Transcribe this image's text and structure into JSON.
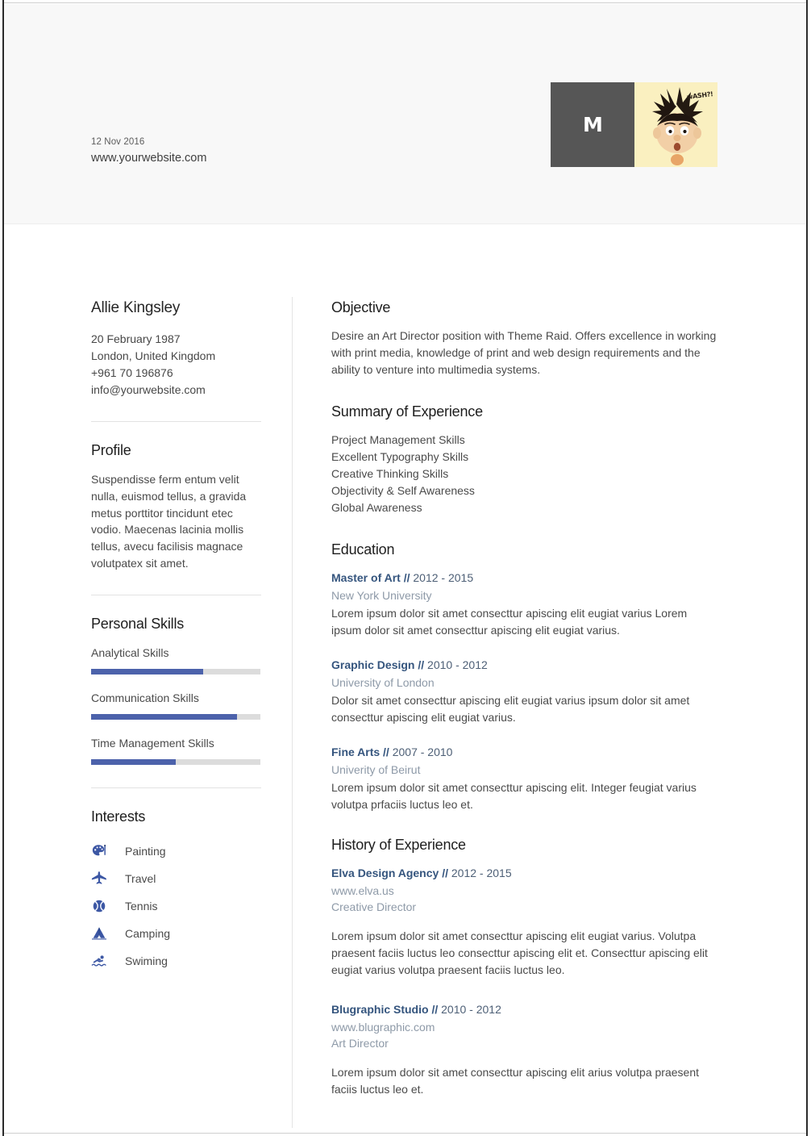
{
  "header": {
    "date": "12 Nov 2016",
    "website": "www.yourwebsite.com",
    "logo_letter": "M",
    "photo_caption": "wASH?!"
  },
  "sidebar": {
    "name": "Allie Kingsley",
    "contact": [
      "20 February 1987",
      "London, United Kingdom",
      "+961 70 196876",
      "info@yourwebsite.com"
    ],
    "profile": {
      "title": "Profile",
      "text": "Suspendisse ferm entum velit nulla, euismod tellus, a gravida metus porttitor tincidunt etec vodio. Maecenas lacinia mollis tellus, avecu facilisis magnace volutpatex sit amet."
    },
    "personal_skills": {
      "title": "Personal Skills",
      "items": [
        {
          "label": "Analytical Skills",
          "value": 66
        },
        {
          "label": "Communication Skills",
          "value": 86
        },
        {
          "label": "Time Management Skills",
          "value": 50
        }
      ]
    },
    "interests": {
      "title": "Interests",
      "items": [
        {
          "label": "Painting",
          "icon": "palette-icon"
        },
        {
          "label": "Travel",
          "icon": "airplane-icon"
        },
        {
          "label": "Tennis",
          "icon": "tennis-ball-icon"
        },
        {
          "label": "Camping",
          "icon": "tent-icon"
        },
        {
          "label": "Swiming",
          "icon": "swimmer-icon"
        }
      ]
    }
  },
  "main": {
    "objective": {
      "title": "Objective",
      "text": "Desire an Art Director position with Theme Raid. Offers excellence in working with print media, knowledge of print and web design requirements and the ability to venture into multimedia systems."
    },
    "summary": {
      "title": "Summary of Experience",
      "items": [
        "Project Management Skills",
        "Excellent Typography Skills",
        "Creative Thinking Skills",
        "Objectivity & Self Awareness",
        "Global Awareness"
      ]
    },
    "education": {
      "title": "Education",
      "entries": [
        {
          "title": "Master of Art //",
          "date": "2012 - 2015",
          "sub": "New York University",
          "desc": "Lorem ipsum dolor sit amet consecttur apiscing elit eugiat varius Lorem ipsum dolor sit amet consecttur apiscing elit eugiat varius."
        },
        {
          "title": "Graphic Design //",
          "date": "2010 - 2012",
          "sub": "University of London",
          "desc": "Dolor sit amet consecttur apiscing elit eugiat varius  ipsum dolor sit amet consecttur apiscing elit eugiat varius."
        },
        {
          "title": "Fine Arts //",
          "date": "2007 - 2010",
          "sub": "Univerity of Beirut",
          "desc": "Lorem ipsum dolor sit amet consecttur apiscing elit. Integer feugiat varius volutpa prfaciis luctus leo et."
        }
      ]
    },
    "history": {
      "title": "History of Experience",
      "entries": [
        {
          "title": "Elva Design Agency //",
          "date": "2012 - 2015",
          "sub": "www.elva.us",
          "sub2": "Creative Director",
          "desc": "Lorem ipsum dolor sit amet consecttur apiscing elit eugiat varius. Volutpa praesent faciis luctus leo consecttur apiscing elit et. Consecttur apiscing elit eugiat varius volutpa praesent faciis luctus leo."
        },
        {
          "title": "Blugraphic Studio //",
          "date": "2010 - 2012",
          "sub": "www.blugraphic.com",
          "sub2": "Art Director",
          "desc": "Lorem ipsum dolor sit amet consecttur apiscing elit arius volutpa praesent faciis luctus leo et."
        }
      ]
    }
  },
  "colors": {
    "accent_blue": "#4c62ab",
    "heading_blue": "#35557e",
    "muted_blue": "#8e9aa8",
    "logo_dark": "#565656",
    "photo_bg": "#faf0c0"
  }
}
